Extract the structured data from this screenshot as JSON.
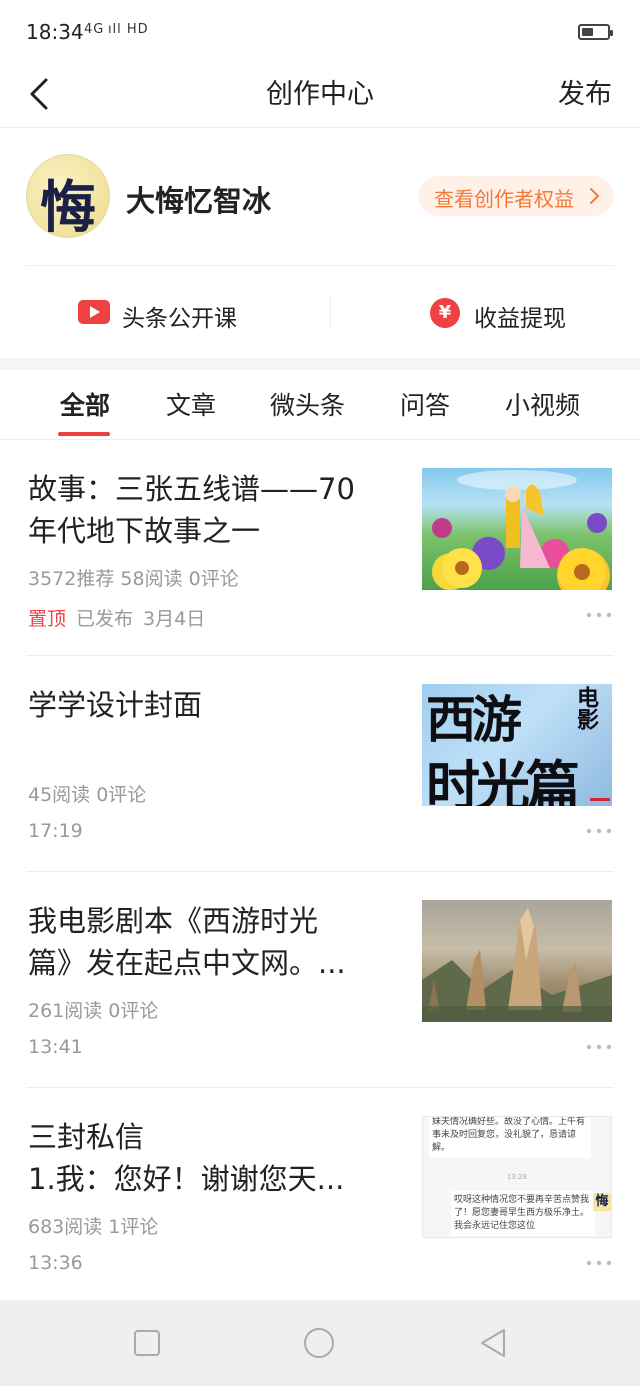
{
  "status_bar": {
    "time": "18:34",
    "signal": "4G ıll HD",
    "battery_level": 0.45
  },
  "nav": {
    "title": "创作中心",
    "publish_label": "发布"
  },
  "profile": {
    "avatar_glyph": "悔",
    "name": "大悔忆智冰",
    "benefit_label": "查看创作者权益"
  },
  "shortcuts": {
    "course_label": "头条公开课",
    "income_label": "收益提现",
    "income_icon_glyph": "¥"
  },
  "tabs": [
    {
      "label": "全部",
      "active": true
    },
    {
      "label": "文章",
      "active": false
    },
    {
      "label": "微头条",
      "active": false
    },
    {
      "label": "问答",
      "active": false
    },
    {
      "label": "小视频",
      "active": false
    }
  ],
  "items": [
    {
      "title": "故事：三张五线谱——70\n年代地下故事之一",
      "stats": "3572推荐   58阅读   0评论",
      "pinned": "置顶",
      "status": "已发布",
      "date": "3月4日",
      "thumb": "fairy-tale-illustration"
    },
    {
      "title": "学学设计封面",
      "stats": "45阅读   0评论",
      "date": "17:19",
      "thumb": "calligraphy-cover",
      "thumb_text_line1": "西游",
      "thumb_text_side": "电影",
      "thumb_text_line2": "时光篇"
    },
    {
      "title": "我电影剧本《西游时光\n篇》发在起点中文网。...",
      "stats": "261阅读   0评论",
      "date": "13:41",
      "thumb": "fantasy-landscape"
    },
    {
      "title": "三封私信\n1.我：您好！谢谢您天...",
      "stats": "683阅读   1评论",
      "date": "13:36",
      "thumb": "chat-screenshot",
      "thumb_chat_top": "妹夫情况确好些。故没了心情。上午有事未及时回复您，没礼貌了，恳请谅解。",
      "thumb_chat_time": "13:28",
      "thumb_chat_bottom": "哎呀这种情况您不要再辛苦点赞我了！愿您妻哥早生西方极乐净土。我会永远记住您这位",
      "thumb_chat_avatar": "悔"
    }
  ],
  "colors": {
    "accent_red": "#f04142",
    "benefit_orange": "#f47a3b",
    "meta_gray": "#999999"
  }
}
